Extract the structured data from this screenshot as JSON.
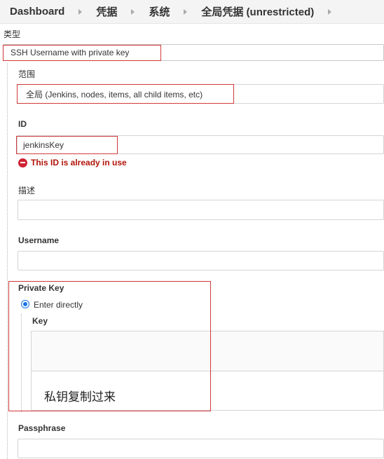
{
  "breadcrumb": {
    "items": [
      "Dashboard",
      "凭据",
      "系统",
      "全局凭据 (unrestricted)"
    ]
  },
  "form": {
    "kind_label": "类型",
    "kind_value": "SSH Username with private key",
    "scope_label": "范围",
    "scope_value": "全局 (Jenkins, nodes, items, all child items, etc)",
    "id_label": "ID",
    "id_value": "jenkinsKey",
    "id_error": "This ID is already in use",
    "description_label": "描述",
    "description_value": "",
    "username_label": "Username",
    "username_value": "",
    "private_key_label": "Private Key",
    "enter_directly_label": "Enter directly",
    "key_label": "Key",
    "key_text": "私钥复制过来",
    "passphrase_label": "Passphrase",
    "passphrase_value": ""
  },
  "colors": {
    "highlight": "#d0393a",
    "error": "#b1140a",
    "radio": "#1a73e8"
  }
}
